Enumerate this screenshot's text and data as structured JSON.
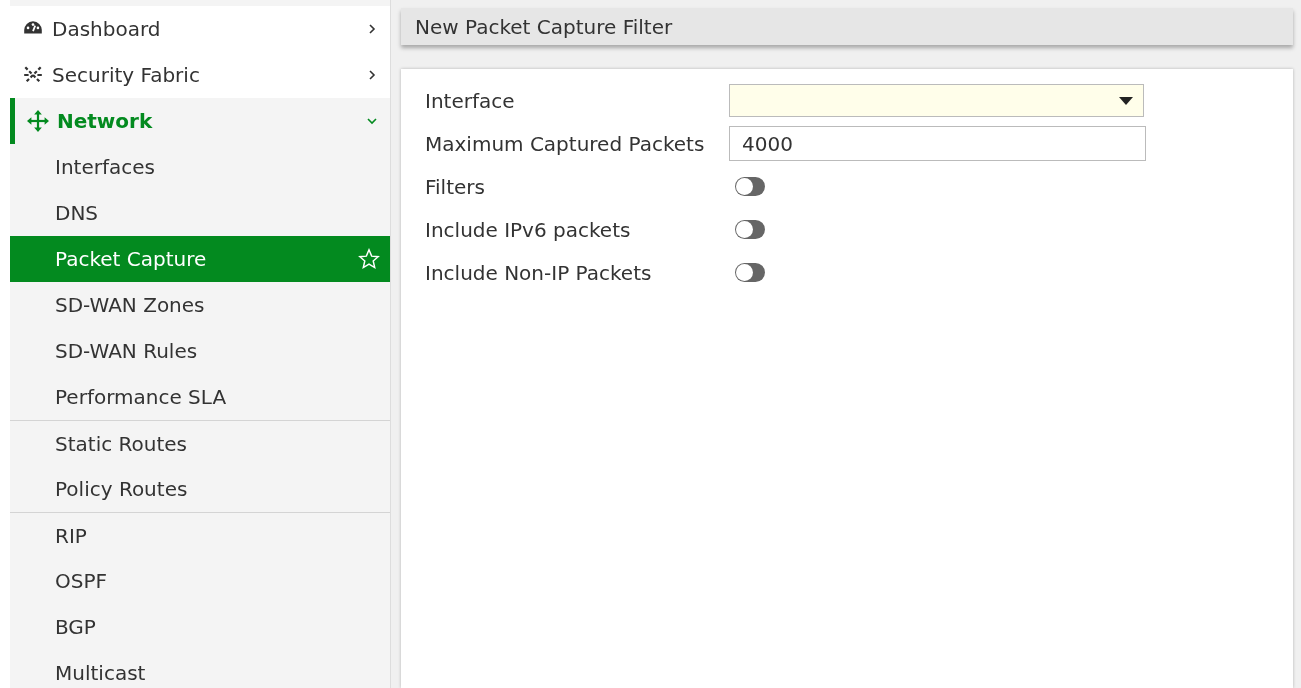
{
  "sidebar": {
    "items": [
      {
        "label": "Dashboard",
        "expanded": false,
        "selected": false
      },
      {
        "label": "Security Fabric",
        "expanded": false,
        "selected": false
      },
      {
        "label": "Network",
        "expanded": true,
        "selected": true,
        "children": [
          {
            "label": "Interfaces",
            "selected": false,
            "separated": false
          },
          {
            "label": "DNS",
            "selected": false,
            "separated": false
          },
          {
            "label": "Packet Capture",
            "selected": true,
            "separated": false
          },
          {
            "label": "SD-WAN Zones",
            "selected": false,
            "separated": false
          },
          {
            "label": "SD-WAN Rules",
            "selected": false,
            "separated": false
          },
          {
            "label": "Performance SLA",
            "selected": false,
            "separated": false
          },
          {
            "label": "Static Routes",
            "selected": false,
            "separated": true
          },
          {
            "label": "Policy Routes",
            "selected": false,
            "separated": false
          },
          {
            "label": "RIP",
            "selected": false,
            "separated": true
          },
          {
            "label": "OSPF",
            "selected": false,
            "separated": false
          },
          {
            "label": "BGP",
            "selected": false,
            "separated": false
          },
          {
            "label": "Multicast",
            "selected": false,
            "separated": false
          }
        ]
      }
    ]
  },
  "page": {
    "title": "New Packet Capture Filter",
    "fields": [
      {
        "kind": "select",
        "label": "Interface"
      },
      {
        "kind": "text",
        "label": "Maximum Captured Packets",
        "value": "4000"
      },
      {
        "kind": "toggle",
        "label": "Filters",
        "on": false
      },
      {
        "kind": "toggle",
        "label": "Include IPv6 packets",
        "on": false
      },
      {
        "kind": "toggle",
        "label": "Include Non-IP Packets",
        "on": false
      }
    ]
  }
}
